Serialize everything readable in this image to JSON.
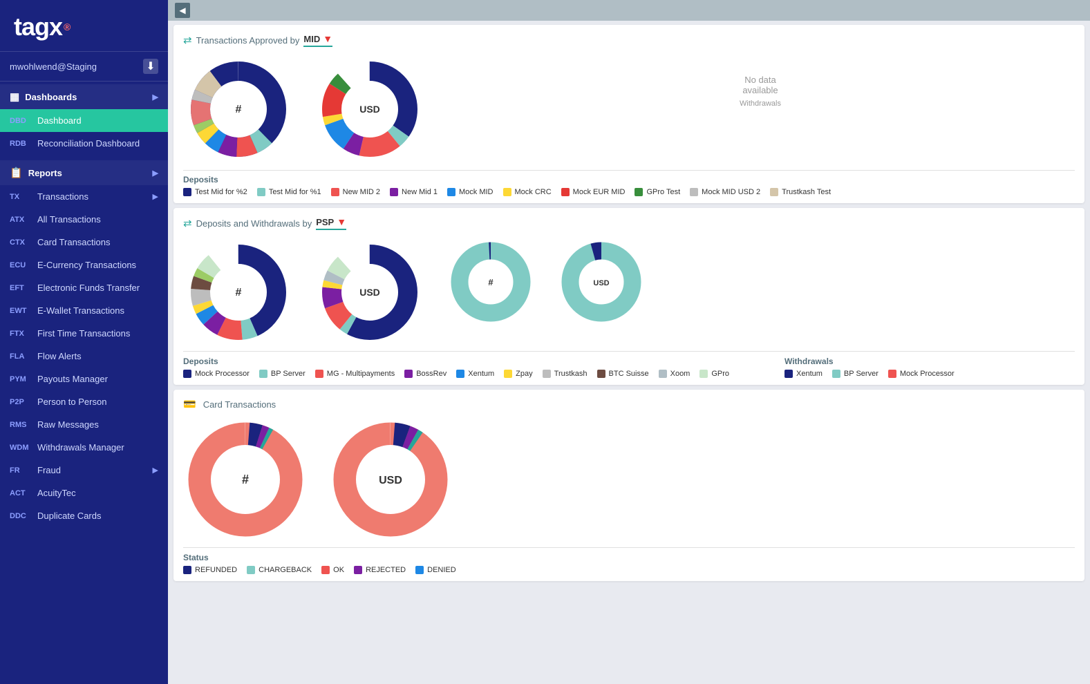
{
  "app": {
    "name": "tagx",
    "registered": "®"
  },
  "user": {
    "name": "mwohlwend@Staging"
  },
  "sidebar": {
    "items": [
      {
        "code": "",
        "label": "Dashboards",
        "type": "section"
      },
      {
        "code": "DBD",
        "label": "Dashboard",
        "active": true
      },
      {
        "code": "RDB",
        "label": "Reconciliation Dashboard"
      },
      {
        "code": "",
        "label": "Reports",
        "type": "section"
      },
      {
        "code": "TX",
        "label": "Transactions",
        "hasArrow": true
      },
      {
        "code": "ATX",
        "label": "All Transactions"
      },
      {
        "code": "CTX",
        "label": "Card Transactions"
      },
      {
        "code": "ECU",
        "label": "E-Currency Transactions"
      },
      {
        "code": "EFT",
        "label": "Electronic Funds Transfer"
      },
      {
        "code": "EWT",
        "label": "E-Wallet Transactions"
      },
      {
        "code": "FTX",
        "label": "First Time Transactions"
      },
      {
        "code": "FLA",
        "label": "Flow Alerts"
      },
      {
        "code": "PYM",
        "label": "Payouts Manager"
      },
      {
        "code": "P2P",
        "label": "Person to Person"
      },
      {
        "code": "RMS",
        "label": "Raw Messages"
      },
      {
        "code": "WDM",
        "label": "Withdrawals Manager"
      },
      {
        "code": "FR",
        "label": "Fraud",
        "hasArrow": true
      },
      {
        "code": "ACT",
        "label": "AcuityTec"
      },
      {
        "code": "DDC",
        "label": "Duplicate Cards"
      }
    ]
  },
  "panels": {
    "transactions_approved": {
      "title": "Transactions Approved by",
      "filter": "MID",
      "deposits_label": "Deposits",
      "legend": [
        {
          "label": "Test Mid for %2",
          "color": "#1a237e"
        },
        {
          "label": "Test Mid for %1",
          "color": "#80cbc4"
        },
        {
          "label": "New MID 2",
          "color": "#ef5350"
        },
        {
          "label": "New Mid 1",
          "color": "#7b1fa2"
        },
        {
          "label": "Mock MID",
          "color": "#1e88e5"
        },
        {
          "label": "Mock CRC",
          "color": "#fdd835"
        },
        {
          "label": "Mock EUR MID",
          "color": "#e53935"
        },
        {
          "label": "GPro Test",
          "color": "#388e3c"
        },
        {
          "label": "Mock MID USD 2",
          "color": "#bdbdbd"
        },
        {
          "label": "Trustkash Test",
          "color": "#d4c5a9"
        }
      ],
      "no_data": "No data\navailable",
      "withdrawals": "Withdrawals"
    },
    "deposits_withdrawals": {
      "title": "Deposits and Withdrawals by",
      "filter": "PSP",
      "deposits_label": "Deposits",
      "withdrawals_label": "Withdrawals",
      "deposits_legend": [
        {
          "label": "Mock Processor",
          "color": "#1a237e"
        },
        {
          "label": "BP Server",
          "color": "#80cbc4"
        },
        {
          "label": "MG - Multipayments",
          "color": "#ef5350"
        },
        {
          "label": "BossRev",
          "color": "#7b1fa2"
        },
        {
          "label": "Xentum",
          "color": "#1e88e5"
        },
        {
          "label": "Zpay",
          "color": "#fdd835"
        },
        {
          "label": "Trustkash",
          "color": "#bdbdbd"
        },
        {
          "label": "BTC Suisse",
          "color": "#6d4c41"
        },
        {
          "label": "Xoom",
          "color": "#b0bec5"
        },
        {
          "label": "GPro",
          "color": "#c8e6c9"
        }
      ],
      "withdrawals_legend": [
        {
          "label": "Xentum",
          "color": "#1a237e"
        },
        {
          "label": "BP Server",
          "color": "#80cbc4"
        },
        {
          "label": "Mock Processor",
          "color": "#ef5350"
        }
      ]
    },
    "card_transactions": {
      "title": "Card Transactions",
      "status_label": "Status",
      "status_legend": [
        {
          "label": "REFUNDED",
          "color": "#1a237e"
        },
        {
          "label": "CHARGEBACK",
          "color": "#80cbc4"
        },
        {
          "label": "OK",
          "color": "#ef5350"
        },
        {
          "label": "REJECTED",
          "color": "#7b1fa2"
        },
        {
          "label": "DENIED",
          "color": "#1e88e5"
        }
      ]
    }
  }
}
